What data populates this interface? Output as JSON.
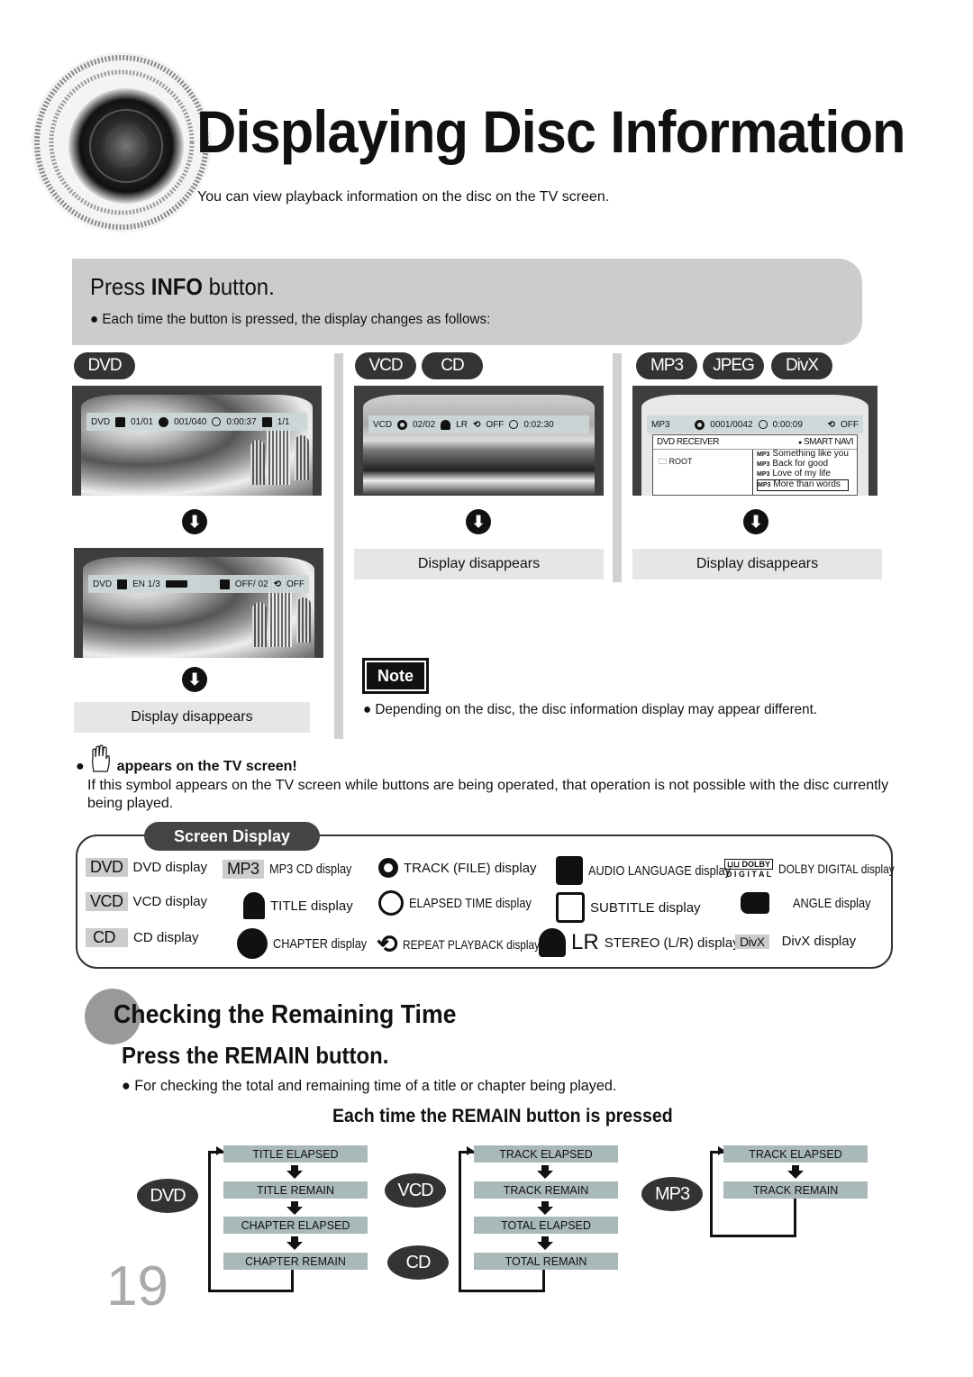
{
  "header": {
    "title": "Displaying Disc Information",
    "subtitle": "You can view playback information on the disc on the TV screen."
  },
  "info": {
    "heading_pre": "Press ",
    "heading_bold": "INFO",
    "heading_post": " button.",
    "bullet": "Each time the button is pressed, the display changes as follows:"
  },
  "columns": {
    "dvd": {
      "pills": [
        "DVD"
      ],
      "screen1": {
        "disc": "DVD",
        "title": "01/01",
        "chapter": "001/040",
        "time": "0:00:37",
        "angle": "1/1"
      },
      "screen2": {
        "disc": "DVD",
        "audio": "EN 1/3",
        "subtitle": "OFF/  02",
        "repeat": "OFF"
      },
      "end_label": "Display disappears"
    },
    "vcd": {
      "pills": [
        "VCD",
        "CD"
      ],
      "screen1": {
        "disc": "VCD",
        "track": "02/02",
        "stereo": "LR",
        "repeat": "OFF",
        "time": "0:02:30"
      },
      "end_label": "Display disappears"
    },
    "mp3": {
      "pills": [
        "MP3",
        "JPEG",
        "DivX"
      ],
      "screen1": {
        "disc": "MP3",
        "track": "0001/0042",
        "time": "0:00:09",
        "repeat": "OFF",
        "menu_title": "DVD RECEIVER",
        "menu_mode": "SMART NAVI",
        "folder": "ROOT",
        "file_tag": "MP3",
        "files": [
          "Something like you",
          "Back for good",
          "Love of my life",
          "More than words"
        ],
        "selected_index": 3
      },
      "end_label": "Display disappears"
    }
  },
  "note": {
    "badge": "Note",
    "text": "Depending on the disc, the disc information display may appear different."
  },
  "hand_note": {
    "heading": "appears on the TV screen!",
    "text": "If this symbol appears on the TV screen while buttons are being operated, that operation is not possible with the disc currently being played."
  },
  "legend": {
    "title": "Screen Display",
    "items": [
      {
        "tag": "DVD",
        "label": "DVD display"
      },
      {
        "tag": "VCD",
        "label": "VCD display"
      },
      {
        "tag": "CD",
        "label": "CD display"
      },
      {
        "tag": "MP3",
        "label": "MP3 CD display"
      },
      {
        "icon": "title-icon",
        "label": "TITLE display"
      },
      {
        "icon": "chapter-icon",
        "label": "CHAPTER display"
      },
      {
        "icon": "track-icon",
        "label": "TRACK (FILE) display"
      },
      {
        "icon": "clock-icon",
        "label": "ELAPSED TIME display"
      },
      {
        "icon": "repeat-icon",
        "label": "REPEAT PLAYBACK display"
      },
      {
        "icon": "audio-language-icon",
        "label": "AUDIO LANGUAGE display"
      },
      {
        "icon": "subtitle-icon",
        "label": "SUBTITLE display"
      },
      {
        "icon": "headphones-icon",
        "tag": "LR",
        "label": "STEREO (L/R) display"
      },
      {
        "icon": "dolby-digital-icon",
        "label": "DOLBY DIGITAL display",
        "dolby_top": "DOLBY",
        "dolby_bottom": "D I G I T A L"
      },
      {
        "icon": "angle-icon",
        "label": "ANGLE display"
      },
      {
        "icon": "divx-icon",
        "tag": "DivX",
        "label": "DivX display"
      }
    ]
  },
  "remain": {
    "heading": "Checking the Remaining Time",
    "subheading": "Press the REMAIN button.",
    "bullet": "For checking the total and remaining time of a title or chapter being played.",
    "each": "Each time the REMAIN button is pressed",
    "dvd": {
      "label": "DVD",
      "steps": [
        "TITLE ELAPSED",
        "TITLE REMAIN",
        "CHAPTER ELAPSED",
        "CHAPTER REMAIN"
      ]
    },
    "vcd": {
      "labels": [
        "VCD",
        "CD"
      ],
      "steps": [
        "TRACK ELAPSED",
        "TRACK REMAIN",
        "TOTAL ELAPSED",
        "TOTAL REMAIN"
      ]
    },
    "mp3": {
      "label": "MP3",
      "steps": [
        "TRACK ELAPSED",
        "TRACK REMAIN"
      ]
    }
  },
  "page_number": "19"
}
